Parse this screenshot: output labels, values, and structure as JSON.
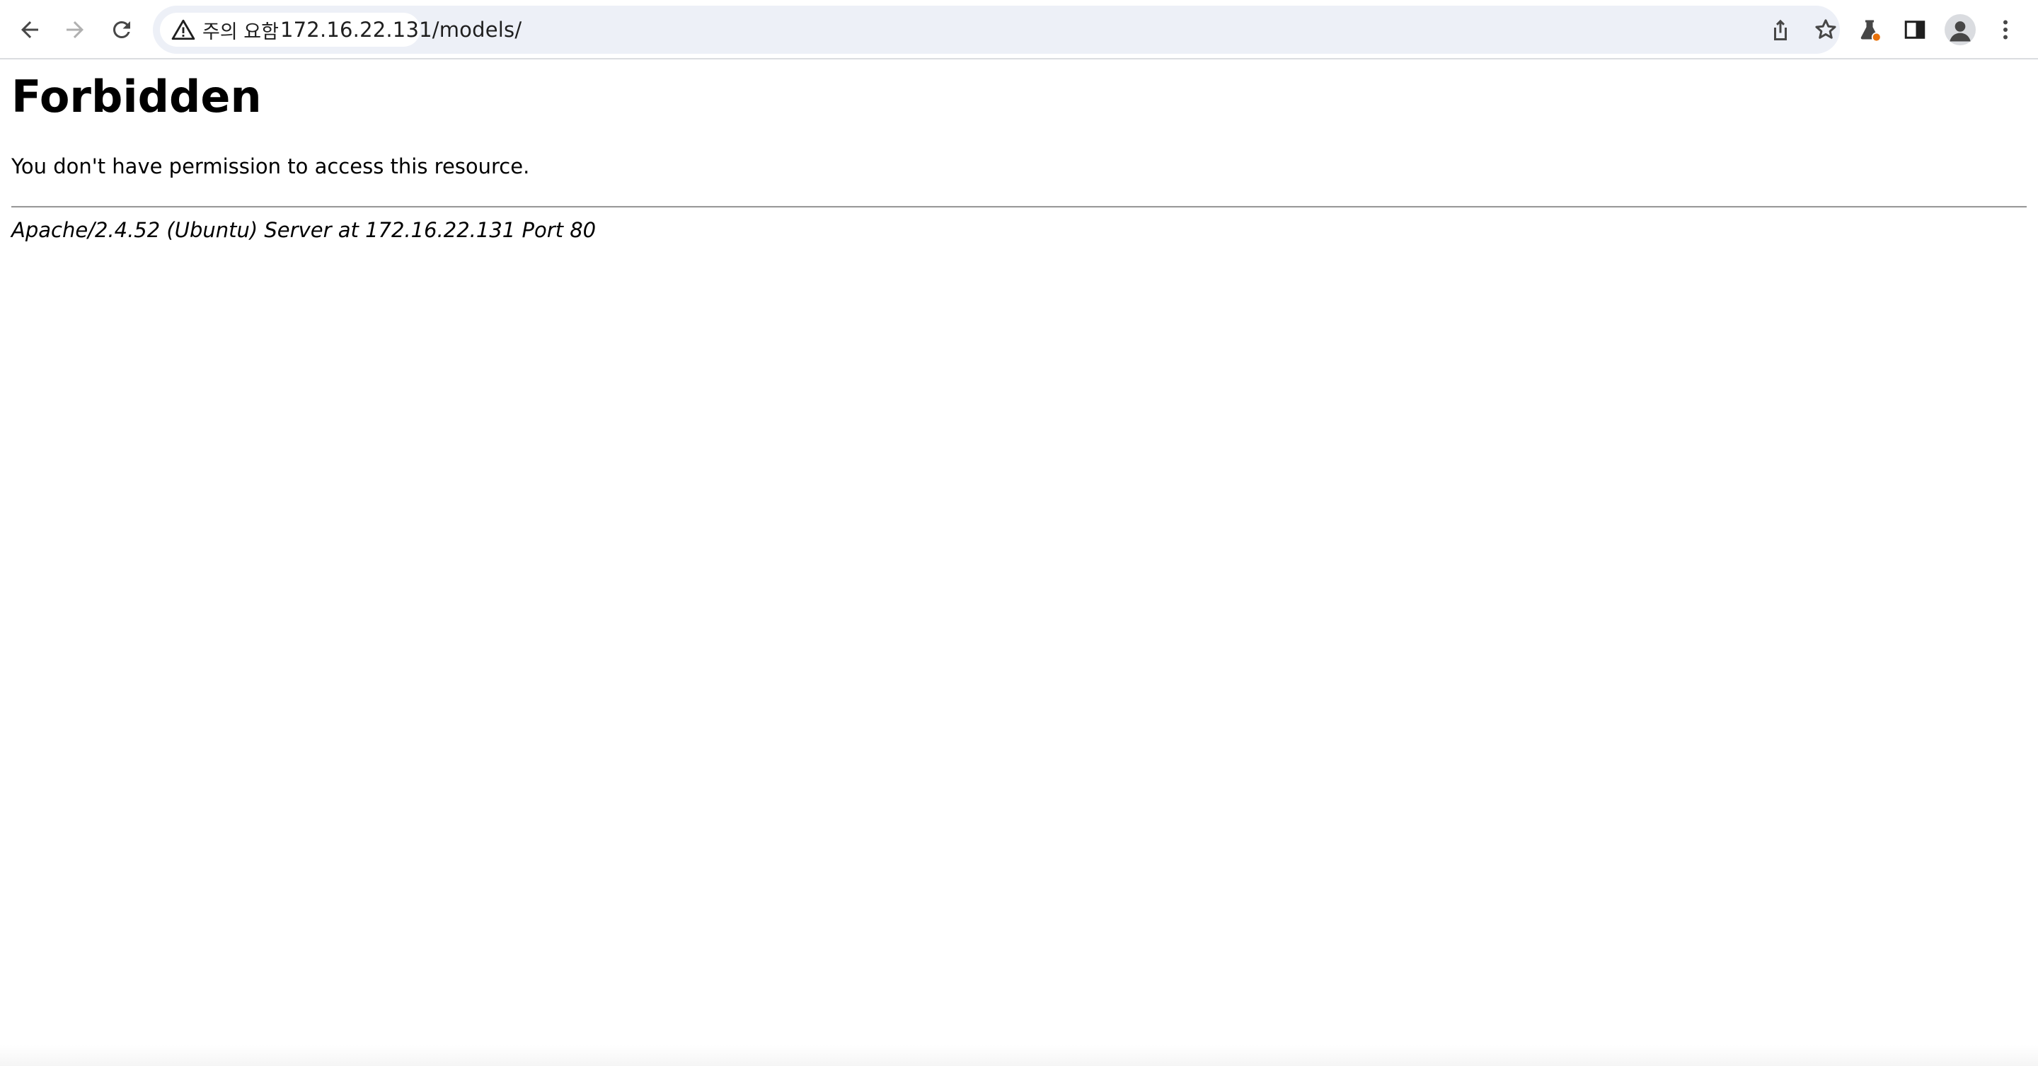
{
  "browser": {
    "security_chip_label": "주의 요함",
    "url": "172.16.22.131/models/",
    "icons": [
      "back-arrow-icon",
      "forward-arrow-icon",
      "reload-icon",
      "warning-triangle-icon",
      "share-icon",
      "star-icon",
      "labs-flask-icon",
      "side-panel-icon",
      "profile-avatar-icon",
      "kebab-menu-icon"
    ],
    "colors": {
      "toolbar_bg": "#ffffff",
      "omnibox_bg": "#edf0f7",
      "labs_badge": "#e8710a"
    }
  },
  "page": {
    "title": "Forbidden",
    "message": "You don't have permission to access this resource.",
    "server_signature": "Apache/2.4.52 (Ubuntu) Server at 172.16.22.131 Port 80"
  }
}
